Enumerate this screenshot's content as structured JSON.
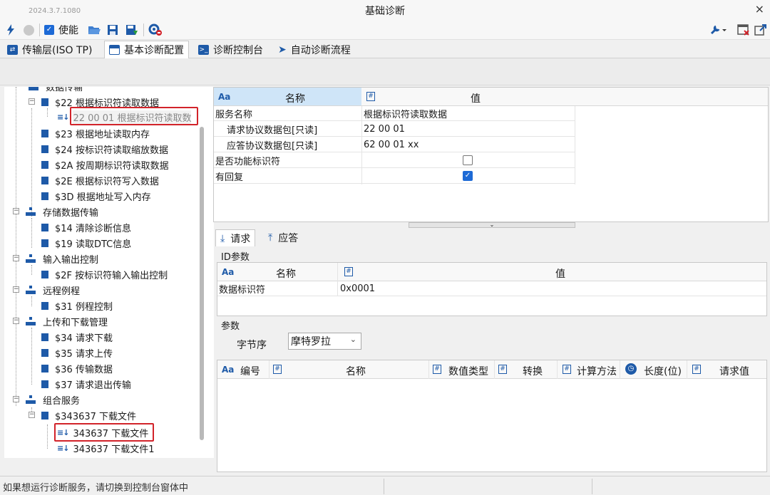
{
  "window": {
    "version": "2024.3.7.1080",
    "title": "基础诊断",
    "close": "×"
  },
  "toolbar": {
    "enable_label": "使能",
    "enable_checked": true
  },
  "tabs": [
    "传输层(ISO TP)",
    "基本诊断配置",
    "诊断控制台",
    "自动诊断流程"
  ],
  "tree": {
    "top_cut": "数据传输",
    "s22": "$22 根据标识符读取数据",
    "s22_child": "22 00 01 根据标识符读取数",
    "s23": "$23 根据地址读取内存",
    "s24": "$24 按标识符读取缩放数据",
    "s2A": "$2A 按周期标识符读取数据",
    "s2E": "$2E 根据标识符写入数据",
    "s3D": "$3D 根据地址写入内存",
    "g_store": "存储数据传输",
    "s14": "$14 清除诊断信息",
    "s19": "$19 读取DTC信息",
    "g_io": "输入输出控制",
    "s2F": "$2F 按标识符输入输出控制",
    "g_remote": "远程例程",
    "s31": "$31 例程控制",
    "g_updown": "上传和下载管理",
    "s34": "$34 请求下载",
    "s35": "$35 请求上传",
    "s36": "$36 传输数据",
    "s37": "$37 请求退出传输",
    "g_combo": "组合服务",
    "s343637": "$343637 下载文件",
    "c1": "343637 下载文件",
    "c2": "343637 下载文件1"
  },
  "props": {
    "col_name": "名称",
    "col_value": "值",
    "rows": [
      {
        "name": "服务名称",
        "value": "根据标识符读取数据"
      },
      {
        "name": "请求协议数据包[只读]",
        "value": "22 00 01"
      },
      {
        "name": "应答协议数据包[只读]",
        "value": "62 00 01 xx"
      },
      {
        "name": "是否功能标识符",
        "checked": false
      },
      {
        "name": "有回复",
        "checked": true
      }
    ]
  },
  "subtabs": {
    "request": "请求",
    "response": "应答"
  },
  "id_params": {
    "group": "ID参数",
    "col_name": "名称",
    "col_value": "值",
    "row": {
      "name": "数据标识符",
      "value": "0x0001"
    }
  },
  "params": {
    "group": "参数",
    "byte_order_label": "字节序",
    "byte_order_value": "摩特罗拉",
    "columns": [
      "编号",
      "名称",
      "数值类型",
      "转换",
      "计算方法",
      "长度(位)",
      "请求值"
    ]
  },
  "status": {
    "message": "如果想运行诊断服务，请切换到控制台窗体中"
  },
  "colors": {
    "accent": "#1d6ad6",
    "highlight": "#d2232a",
    "icon": "#1e5aa8"
  }
}
